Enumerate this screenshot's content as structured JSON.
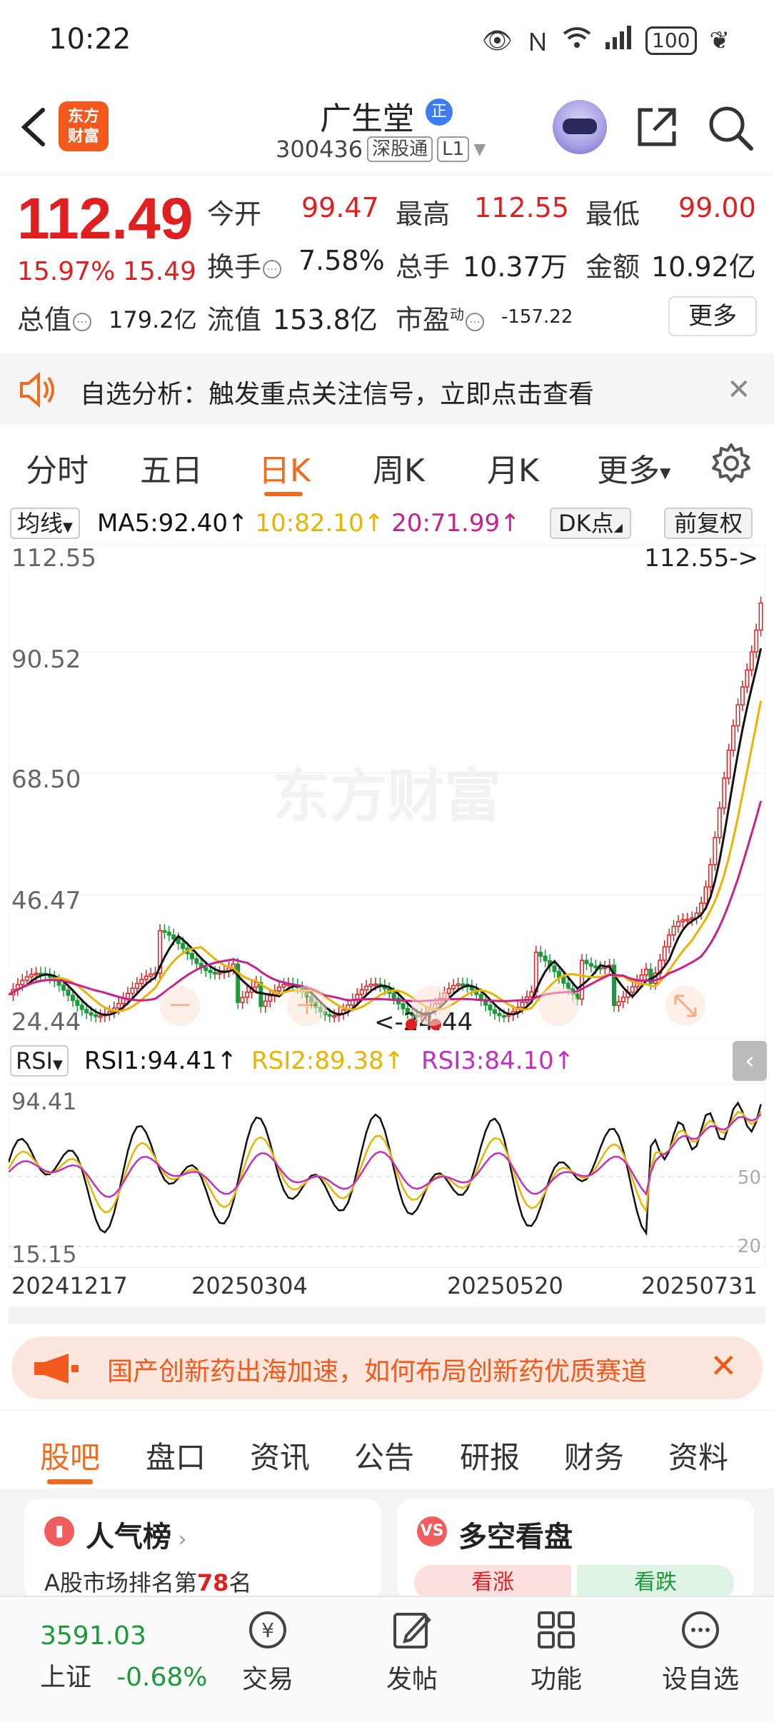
{
  "status_bar": {
    "time": "10:22",
    "battery": "100"
  },
  "header": {
    "logo_line1": "东方",
    "logo_line2": "财富",
    "stock_name": "广生堂",
    "verified_badge": "正",
    "stock_code": "300436",
    "connect_tag": "深股通",
    "level_tag": "L1"
  },
  "quote": {
    "price": "112.49",
    "change_pct": "15.97%",
    "change_abs": "15.49",
    "open_label": "今开",
    "open_value": "99.47",
    "high_label": "最高",
    "high_value": "112.55",
    "low_label": "最低",
    "low_value": "99.00",
    "turnover_label": "换手",
    "turnover_value": "7.58%",
    "volume_label": "总手",
    "volume_value": "10.37万",
    "amount_label": "金额",
    "amount_value": "10.92亿",
    "mcap_label": "总值",
    "mcap_value": "179.2亿",
    "float_label": "流值",
    "float_value": "153.8亿",
    "pe_label": "市盈",
    "pe_superscript": "动",
    "pe_value": "-157.22",
    "more_label": "更多"
  },
  "notice": {
    "text": "自选分析：触发重点关注信号，立即点击查看"
  },
  "chart_tabs": [
    "分时",
    "五日",
    "日K",
    "周K",
    "月K",
    "更多"
  ],
  "ma_legend": {
    "select": "均线",
    "ma5": "MA5:92.40↑",
    "ma10": "10:82.10↑",
    "ma20": "20:71.99↑",
    "dk": "DK点",
    "adjust": "前复权"
  },
  "kline": {
    "y_labels": [
      "112.55",
      "90.52",
      "68.50",
      "46.47",
      "24.44"
    ],
    "high_marker": "112.55->",
    "low_marker": "<-24.44",
    "watermark": "东方财富"
  },
  "rsi_legend": {
    "select": "RSI",
    "rsi1": "RSI1:94.41↑",
    "rsi2": "RSI2:89.38↑",
    "rsi3": "RSI3:84.10↑",
    "y_top": "94.41",
    "y_bottom": "15.15",
    "ref_50": "50",
    "ref_20": "20"
  },
  "dates": [
    "20241217",
    "20250304",
    "20250520",
    "20250731"
  ],
  "promo": {
    "text": "国产创新药出海加速，如何布局创新药优质赛道"
  },
  "bottom_tabs": [
    "股吧",
    "盘口",
    "资讯",
    "公告",
    "研报",
    "财务",
    "资料"
  ],
  "cards": {
    "popularity_title": "人气榜",
    "popularity_sub_prefix": "A股市场排名第",
    "popularity_rank": "78",
    "popularity_sub_suffix": "名",
    "vs_title": "多空看盘",
    "vs_icon": "VS",
    "bull": "看涨",
    "bear": "看跌"
  },
  "bottom_nav": {
    "index_value": "3591.03",
    "index_name": "上证",
    "index_change": "-0.68%",
    "trade": "交易",
    "post": "发帖",
    "function": "功能",
    "watchlist": "设自选"
  },
  "colors": {
    "up": "#e02020",
    "down": "#1a9a3a",
    "accent": "#f26b1d",
    "ma5": "#111111",
    "ma10": "#e8b400",
    "ma20": "#c8208c"
  }
}
